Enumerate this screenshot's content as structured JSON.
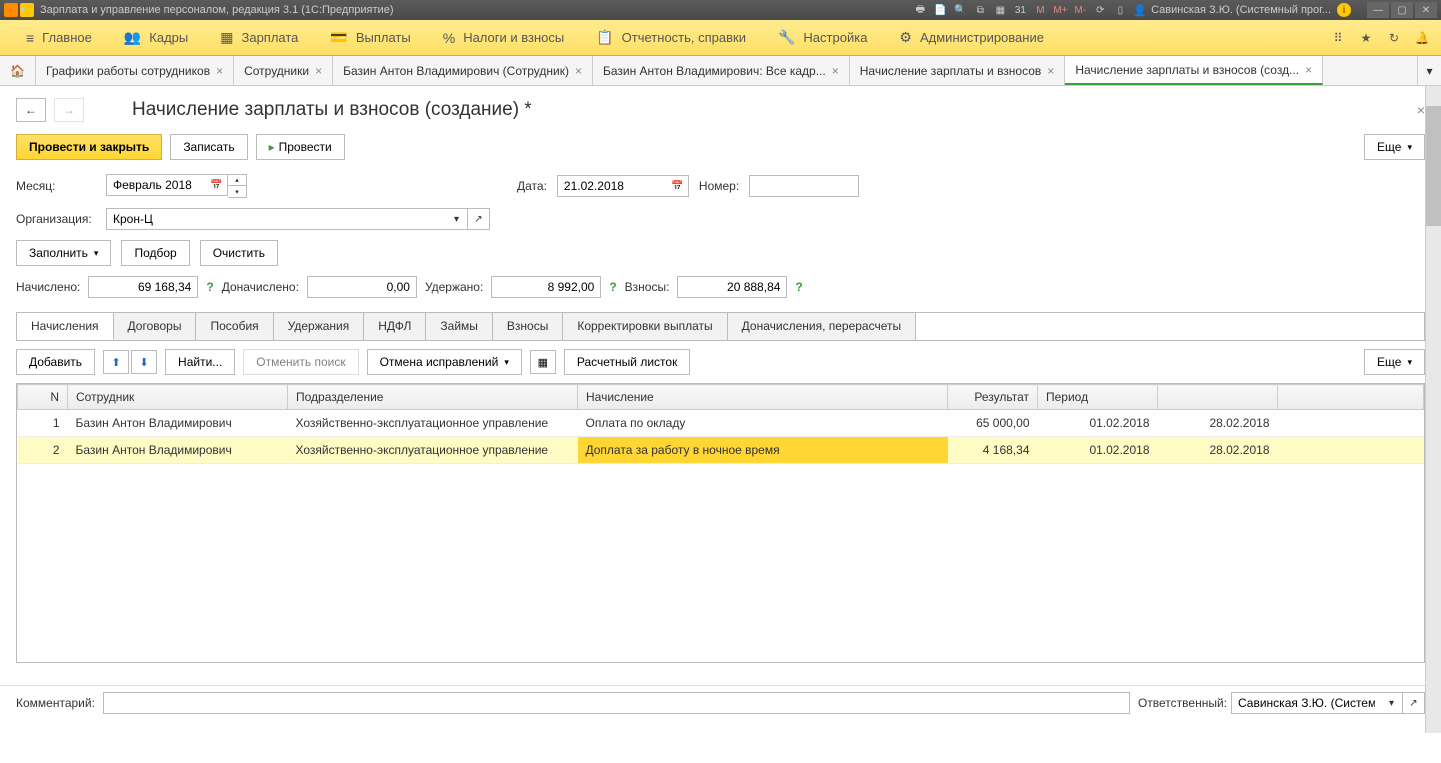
{
  "titleBar": {
    "appTitle": "Зарплата и управление персоналом, редакция 3.1  (1С:Предприятие)",
    "m_labels": [
      "M",
      "M+",
      "M-"
    ],
    "cal_label": "31",
    "user": "Савинская З.Ю. (Системный прог...",
    "infoIcon": "i"
  },
  "mainMenu": {
    "items": [
      {
        "label": "Главное",
        "icon": "≡"
      },
      {
        "label": "Кадры",
        "icon": "👥"
      },
      {
        "label": "Зарплата",
        "icon": "▦"
      },
      {
        "label": "Выплаты",
        "icon": "💳"
      },
      {
        "label": "Налоги и взносы",
        "icon": "%"
      },
      {
        "label": "Отчетность, справки",
        "icon": "📋"
      },
      {
        "label": "Настройка",
        "icon": "🔧"
      },
      {
        "label": "Администрирование",
        "icon": "⚙"
      }
    ]
  },
  "tabs": [
    {
      "label": "Графики работы сотрудников"
    },
    {
      "label": "Сотрудники"
    },
    {
      "label": "Базин Антон Владимирович (Сотрудник)"
    },
    {
      "label": "Базин Антон Владимирович: Все кадр..."
    },
    {
      "label": "Начисление зарплаты и взносов"
    },
    {
      "label": "Начисление зарплаты и взносов (созд...",
      "active": true
    }
  ],
  "pageTitle": "Начисление зарплаты и взносов (создание) *",
  "toolbar": {
    "postAndClose": "Провести и закрыть",
    "write": "Записать",
    "post": "Провести",
    "more": "Еще"
  },
  "form": {
    "monthLabel": "Месяц:",
    "monthValue": "Февраль 2018",
    "dateLabel": "Дата:",
    "dateValue": "21.02.2018",
    "numberLabel": "Номер:",
    "numberValue": "",
    "orgLabel": "Организация:",
    "orgValue": "Крон-Ц"
  },
  "actionRow": {
    "fill": "Заполнить",
    "select": "Подбор",
    "clear": "Очистить"
  },
  "summary": {
    "accruedLabel": "Начислено:",
    "accruedValue": "69 168,34",
    "addAccruedLabel": "Доначислено:",
    "addAccruedValue": "0,00",
    "withheldLabel": "Удержано:",
    "withheldValue": "8 992,00",
    "contribLabel": "Взносы:",
    "contribValue": "20 888,84"
  },
  "subTabs": [
    "Начисления",
    "Договоры",
    "Пособия",
    "Удержания",
    "НДФЛ",
    "Займы",
    "Взносы",
    "Корректировки выплаты",
    "Доначисления, перерасчеты"
  ],
  "subToolbar": {
    "add": "Добавить",
    "find": "Найти...",
    "cancelSearch": "Отменить поиск",
    "cancelFix": "Отмена исправлений",
    "payslip": "Расчетный листок",
    "more": "Еще"
  },
  "table": {
    "headers": [
      "N",
      "Сотрудник",
      "Подразделение",
      "Начисление",
      "Результат",
      "Период",
      "",
      ""
    ],
    "rows": [
      {
        "n": "1",
        "emp": "Базин Антон Владимирович",
        "dept": "Хозяйственно-эксплуатационное управление",
        "accr": "Оплата по окладу",
        "result": "65 000,00",
        "p1": "01.02.2018",
        "p2": "28.02.2018"
      },
      {
        "n": "2",
        "emp": "Базин Антон Владимирович",
        "dept": "Хозяйственно-эксплуатационное управление",
        "accr": "Доплата за работу в ночное время",
        "result": "4 168,34",
        "p1": "01.02.2018",
        "p2": "28.02.2018",
        "selected": true
      }
    ]
  },
  "footer": {
    "commentLabel": "Комментарий:",
    "commentValue": "",
    "responsibleLabel": "Ответственный:",
    "responsibleValue": "Савинская З.Ю. (Системн"
  }
}
